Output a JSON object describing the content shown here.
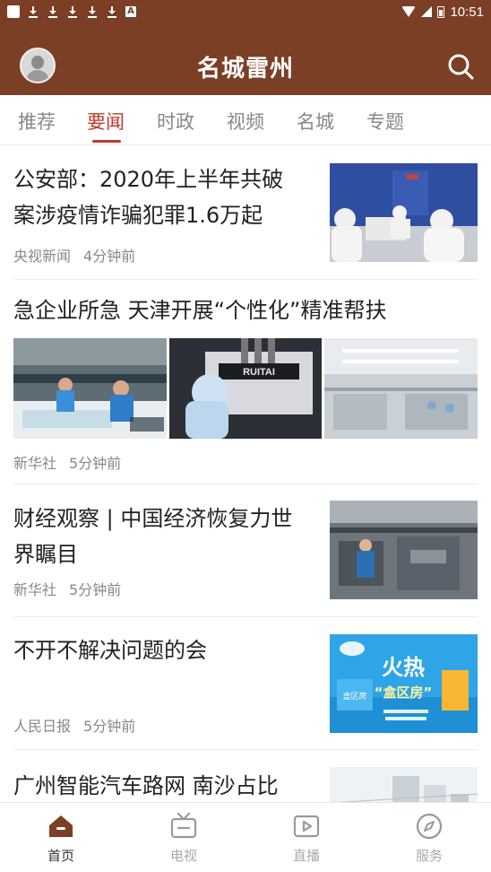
{
  "status_bar": {
    "time": "10:51"
  },
  "header": {
    "title": "名城雷州"
  },
  "tabs": [
    "推荐",
    "要闻",
    "时政",
    "视频",
    "名城",
    "专题"
  ],
  "active_tab": "要闻",
  "articles": [
    {
      "title_lines": [
        "公安部：2020年上半年共破",
        "案涉疫情诈骗犯罪1.6万起"
      ],
      "source": "央视新闻",
      "time": "4分钟前"
    },
    {
      "title_lines": [
        "急企业所急  天津开展“个性化”精准帮扶"
      ],
      "source": "新华社",
      "time": "5分钟前",
      "image_text": "RUITAI"
    },
    {
      "title_lines": [
        "财经观察 | 中国经济恢复力世",
        "界瞩目"
      ],
      "source": "新华社",
      "time": "5分钟前"
    },
    {
      "title_lines": [
        "不开不解决问题的会"
      ],
      "source": "人民日报",
      "time": "5分钟前",
      "image_text": {
        "main": "火热",
        "sub": "“盒区房”",
        "badge": "盒区房"
      }
    },
    {
      "title_lines": [
        "广州智能汽车路网 南沙占比"
      ]
    }
  ],
  "tab_bar": [
    {
      "label": "首页",
      "icon": "home-icon",
      "active": true
    },
    {
      "label": "电视",
      "icon": "tv-icon",
      "active": false
    },
    {
      "label": "直播",
      "icon": "live-icon",
      "active": false
    },
    {
      "label": "服务",
      "icon": "compass-icon",
      "active": false
    }
  ],
  "colors": {
    "brand": "#7b3f25",
    "accent": "#c0392b",
    "text": "#222222",
    "meta": "#888888"
  }
}
